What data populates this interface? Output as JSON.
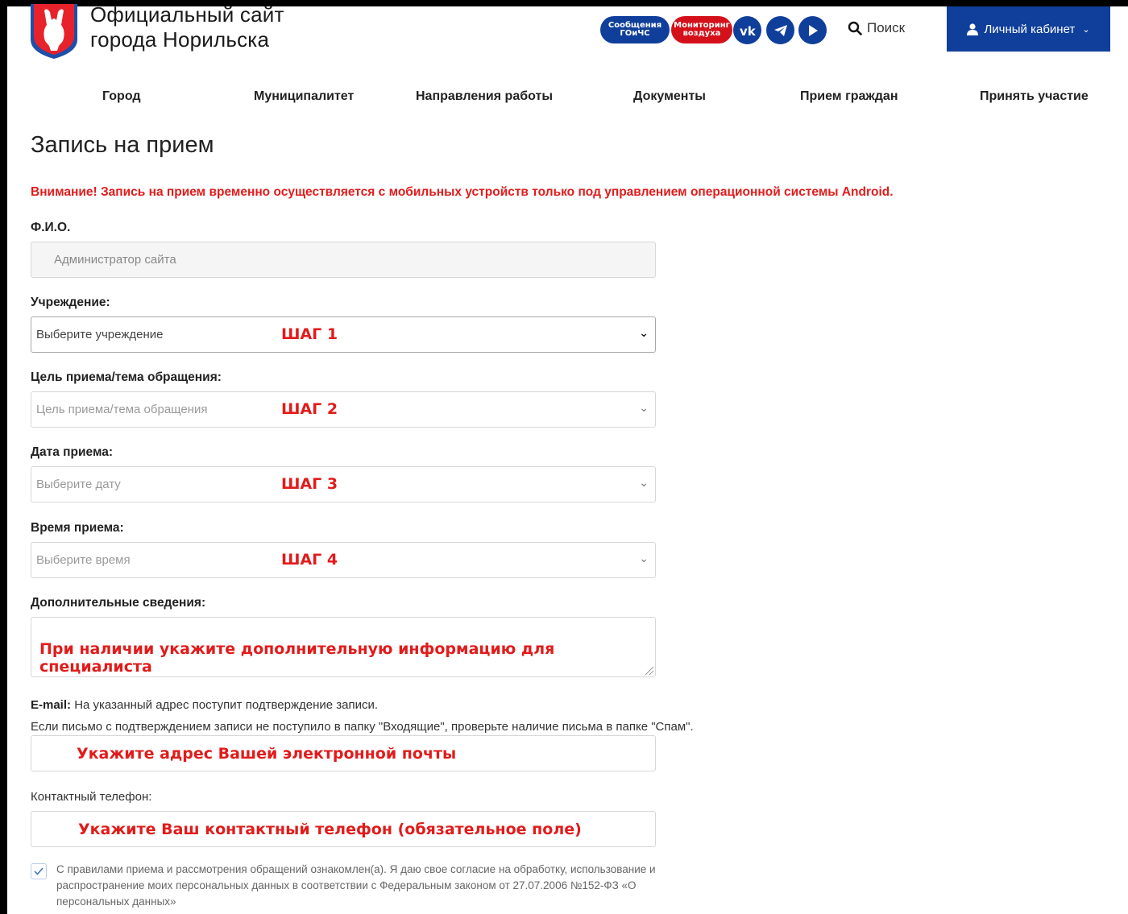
{
  "header": {
    "title_line1": "Официальный сайт",
    "title_line2": "города Норильска",
    "pill_messages_line1": "Сообщения",
    "pill_messages_line2": "ГОиЧС",
    "pill_monitoring_line1": "Мониторинг",
    "pill_monitoring_line2": "воздуха",
    "search_label": "Поиск",
    "account_label": "Личный кабинет",
    "brand_color": "#0f3f9a",
    "alert_color": "#d4111a"
  },
  "nav": {
    "items": [
      "Город",
      "Муниципалитет",
      "Направления работы",
      "Документы",
      "Прием граждан",
      "Принять участие"
    ]
  },
  "page": {
    "title": "Запись на прием",
    "warning": "Внимание! Запись на прием временно осуществляется с мобильных устройств только под управлением операционной системы Android."
  },
  "form": {
    "fio_label": "Ф.И.О.",
    "fio_value": "Администратор сайта",
    "institution_label": "Учреждение:",
    "institution_placeholder": "Выберите учреждение",
    "purpose_label": "Цель приема/тема обращения:",
    "purpose_placeholder": "Цель приема/тема обращения",
    "date_label": "Дата приема:",
    "date_placeholder": "Выберите дату",
    "time_label": "Время приема:",
    "time_placeholder": "Выберите время",
    "extra_label": "Дополнительные сведения:",
    "extra_hint": "При наличии укажите дополнительную информацию для специалиста",
    "email_label": "E-mail:",
    "email_note1": "На указанный адрес поступит подтверждение записи.",
    "email_note2": "Если письмо с подтверждением записи не поступило в папку \"Входящие\", проверьте наличие письма в папке \"Спам\".",
    "email_hint": "Укажите адрес Вашей электронной почты",
    "phone_label": "Контактный телефон:",
    "phone_hint": "Укажите Ваш контактный телефон (обязательное поле)",
    "agree_text": "С правилами приема и рассмотрения обращений ознакомлен(а). Я даю свое согласие на обработку, использование и распространение моих персональных данных в соответствии с Федеральным законом от 27.07.2006 №152-ФЗ «О персональных данных»",
    "agree_checked": true
  },
  "steps": {
    "step1": "ШАГ 1",
    "step2": "ШАГ 2",
    "step3": "ШАГ 3",
    "step4": "ШАГ 4"
  }
}
